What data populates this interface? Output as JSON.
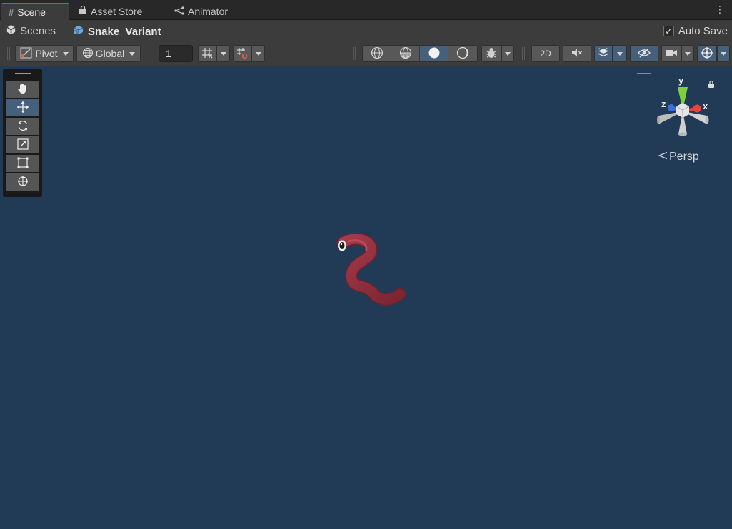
{
  "tabs": [
    {
      "label": "Scene",
      "icon": "hash-grid-icon",
      "active": true
    },
    {
      "label": "Asset Store",
      "icon": "shopping-bag-icon",
      "active": false
    },
    {
      "label": "Animator",
      "icon": "animator-node-icon",
      "active": false
    }
  ],
  "breadcrumb": {
    "root": "Scenes",
    "current": "Snake_Variant"
  },
  "autosave": {
    "label": "Auto Save",
    "checked": true
  },
  "toolbar": {
    "pivot_label": "Pivot",
    "global_label": "Global",
    "grid_size_value": "1",
    "mode_2d_label": "2D"
  },
  "gizmo": {
    "axis_y": "y",
    "axis_x": "x",
    "axis_z": "z",
    "projection_label": "Persp"
  },
  "colors": {
    "scene_background": "#213a55",
    "accent_blue": "#46607c",
    "snake_body": "#8f2f3c",
    "axis_y_green": "#7fd13b",
    "axis_x_red": "#e0493a",
    "axis_z_blue": "#3a6fe0"
  }
}
